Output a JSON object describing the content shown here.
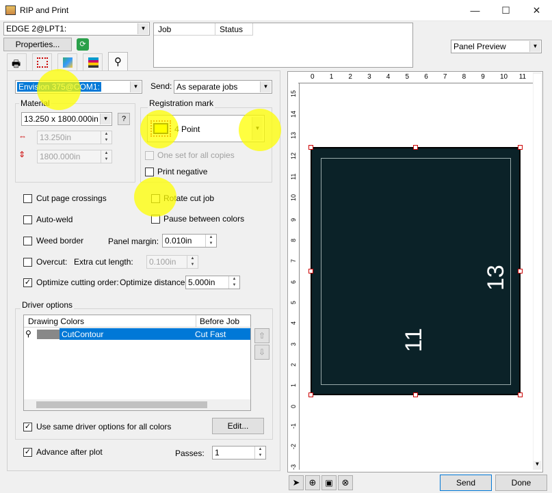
{
  "window": {
    "title": "RIP and Print",
    "minimize": "—",
    "maximize": "☐",
    "close": "✕"
  },
  "device_select": "EDGE 2@LPT1:",
  "properties_label": "Properties...",
  "jobs": {
    "col_job": "Job",
    "col_status": "Status"
  },
  "view_select": "Panel Preview",
  "tabs": [
    "general-icon",
    "panel-icon",
    "color-icon",
    "color-adjust-icon",
    "cut-icon"
  ],
  "cutter_select": "Envision 375@COM1:",
  "send": {
    "label": "Send:",
    "value": "As separate jobs"
  },
  "material": {
    "title": "Material",
    "size": "13.250 x 1800.000in",
    "width": "13.250in",
    "height": "1800.000in"
  },
  "registration": {
    "title": "Registration mark",
    "value": "4 Point",
    "one_set": "One set for all copies",
    "print_negative": "Print negative"
  },
  "options": {
    "cut_page_crossings": "Cut page crossings",
    "rotate_cut_job": "Rotate cut job",
    "auto_weld": "Auto-weld",
    "pause_between_colors": "Pause between colors",
    "weed_border": "Weed border",
    "panel_margin_label": "Panel margin:",
    "panel_margin": "0.010in",
    "overcut": "Overcut:",
    "extra_cut_length_label": "Extra cut length:",
    "extra_cut_length": "0.100in",
    "optimize_cutting_order": "Optimize cutting order:",
    "optimize_distance_label": "Optimize distance:",
    "optimize_distance": "5.000in"
  },
  "driver": {
    "title": "Driver options",
    "col_colors": "Drawing Colors",
    "col_before": "Before Job",
    "row_color_name": "CutContour",
    "row_before": "Cut Fast",
    "use_same": "Use same driver options for all colors",
    "edit": "Edit..."
  },
  "advance_after_plot": "Advance after plot",
  "passes_label": "Passes:",
  "passes": "1",
  "preview": {
    "ruler_h": [
      "0",
      "1",
      "2",
      "3",
      "4",
      "5",
      "6",
      "7",
      "8",
      "9",
      "10",
      "11"
    ],
    "ruler_v": [
      "15",
      "14",
      "13",
      "12",
      "11",
      "10",
      "9",
      "8",
      "7",
      "6",
      "5",
      "4",
      "3",
      "2",
      "1",
      "0",
      "-1",
      "-2",
      "-3"
    ],
    "dim_width": "11",
    "dim_height": "13",
    "panel_color": "#0b2228"
  },
  "buttons": {
    "send": "Send",
    "done": "Done"
  },
  "colors": {
    "selection": "#0078d7",
    "highlight": "#ffff00"
  }
}
